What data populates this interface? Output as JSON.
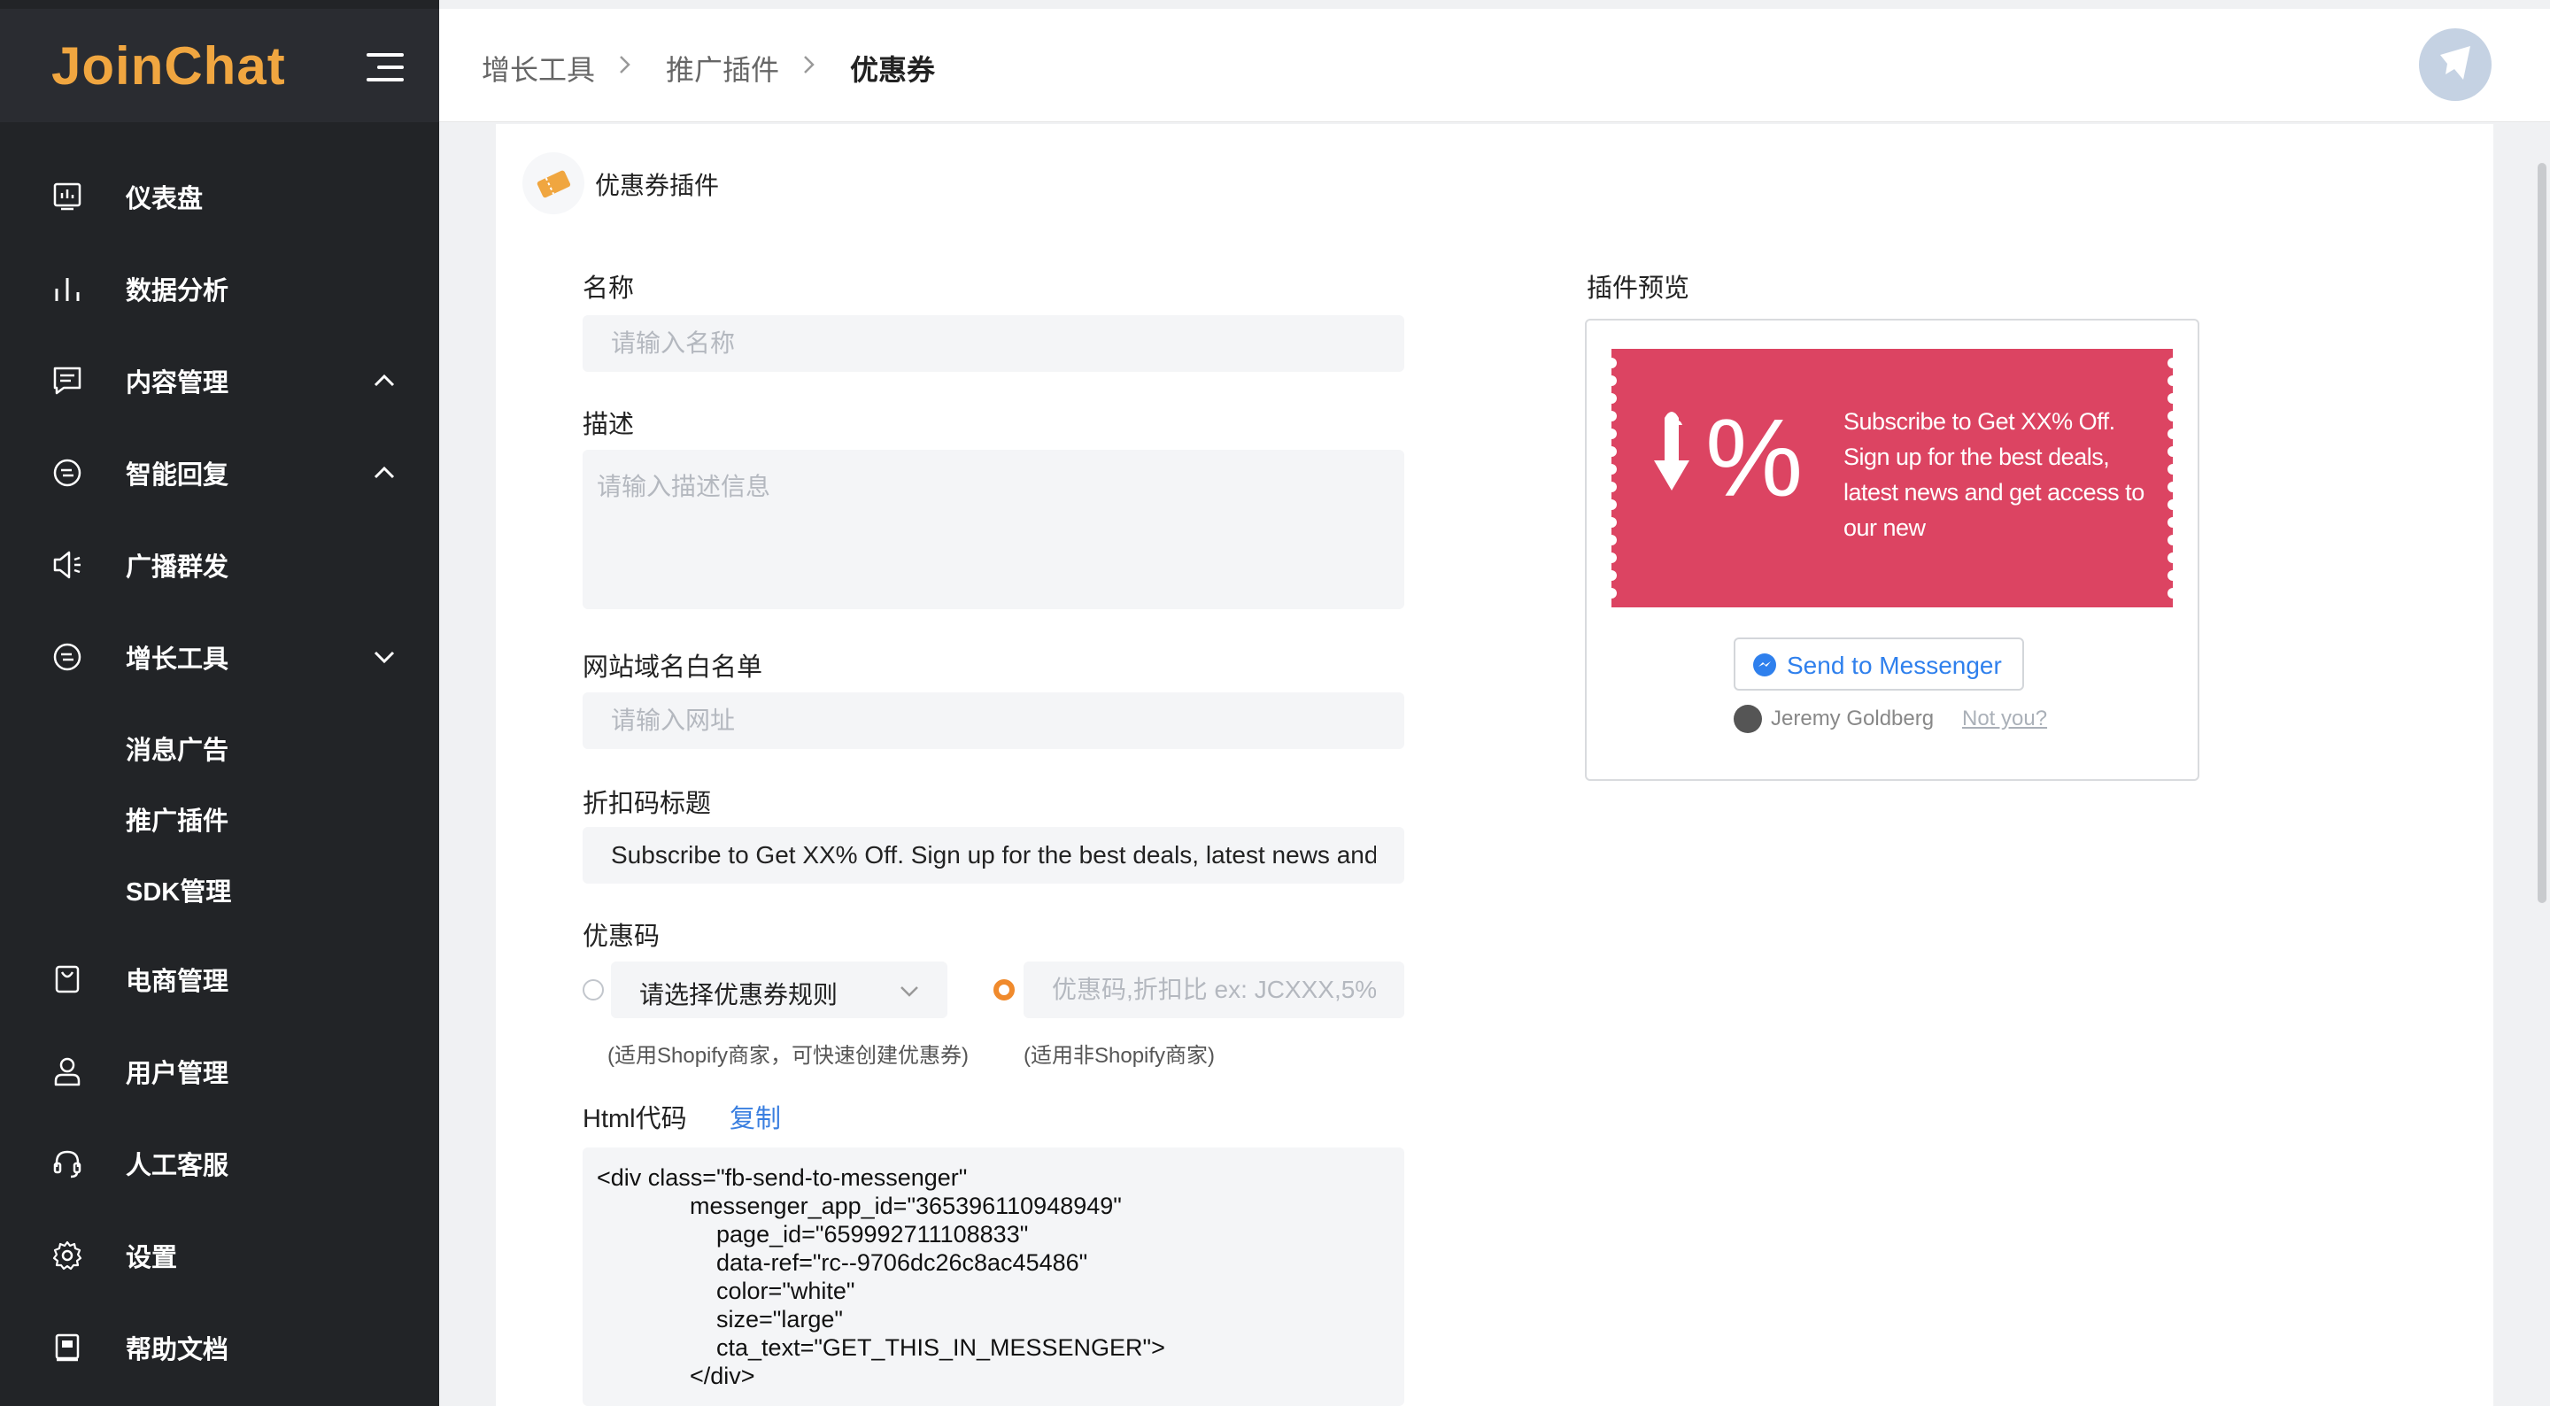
{
  "app": {
    "logo": "JoinChat"
  },
  "sidebar": {
    "items": [
      {
        "label": "仪表盘",
        "icon": "dashboard-icon"
      },
      {
        "label": "数据分析",
        "icon": "bar-chart-icon"
      },
      {
        "label": "内容管理",
        "icon": "message-square-icon"
      },
      {
        "label": "智能回复",
        "icon": "chat-bot-icon"
      },
      {
        "label": "广播群发",
        "icon": "broadcast-icon"
      },
      {
        "label": "增长工具",
        "icon": "growth-icon"
      },
      {
        "label": "电商管理",
        "icon": "shop-bag-icon"
      },
      {
        "label": "用户管理",
        "icon": "user-icon"
      },
      {
        "label": "人工客服",
        "icon": "headset-icon"
      },
      {
        "label": "设置",
        "icon": "gear-icon"
      },
      {
        "label": "帮助文档",
        "icon": "book-icon"
      }
    ],
    "growth_sub": [
      {
        "label": "消息广告"
      },
      {
        "label": "推广插件"
      },
      {
        "label": "SDK管理"
      }
    ]
  },
  "breadcrumb": [
    "增长工具",
    "推广插件",
    "优惠券"
  ],
  "card": {
    "title": "优惠券插件"
  },
  "form": {
    "name_label": "名称",
    "name_placeholder": "请输入名称",
    "desc_label": "描述",
    "desc_placeholder": "请输入描述信息",
    "whitelist_label": "网站域名白名单",
    "whitelist_placeholder": "请输入网址",
    "discount_title_label": "折扣码标题",
    "discount_title_value": "Subscribe to Get XX% Off. Sign up for the best deals, latest news and get access to our new",
    "coupon_label": "优惠码",
    "coupon_rule_placeholder": "请选择优惠券规则",
    "coupon_code_placeholder": "优惠码,折扣比 ex: JCXXX,5%",
    "hint_shopify": "(适用Shopify商家，可快速创建优惠券)",
    "hint_non_shopify": "(适用非Shopify商家)",
    "html_code_label": "Html代码",
    "copy_label": "复制",
    "html_code": "<div class=\"fb-send-to-messenger\"\n              messenger_app_id=\"365396110948949\"\n                  page_id=\"659992711108833\"\n                  data-ref=\"rc--9706dc26c8ac45486\"\n                  color=\"white\"\n                  size=\"large\"\n                  cta_text=\"GET_THIS_IN_MESSENGER\">\n              </div>"
  },
  "preview": {
    "label": "插件预览",
    "coupon_text": "Subscribe to Get XX% Off. Sign up for the best deals, latest news and get access to our new",
    "send_button": "Send to Messenger",
    "user_name": "Jeremy Goldberg",
    "not_you": "Not you?",
    "coupon_color": "#dc4462"
  }
}
